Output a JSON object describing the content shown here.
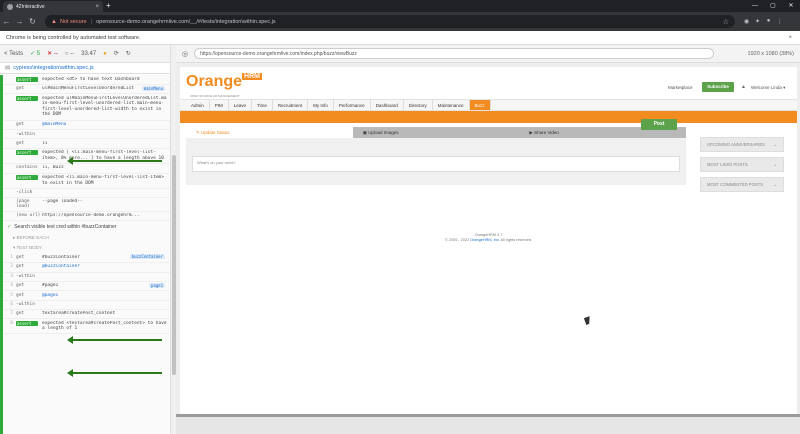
{
  "browser": {
    "tab_title": "42Interactive",
    "new_tab": "+",
    "not_secure": "Not secure",
    "url": "opensource-demo.orangehrmlive.com/__/#/tests/integration\\within.spec.js",
    "automation_notice": "Chrome is being controlled by automated test software."
  },
  "reporter": {
    "tests_label": "< Tests",
    "passed": "5",
    "failed": "--",
    "pending": "--",
    "duration": "33.47",
    "spec_path": "cypress\\integration\\within.spec.js",
    "commands_a": [
      {
        "num": "",
        "name": "assert",
        "msg": "expected <dt> to have text Dashboard",
        "tag": ""
      },
      {
        "num": "",
        "name": "get",
        "msg": "ul#mainMenuFirstLevelUnorderedList",
        "tag": "mainMenu"
      },
      {
        "num": "",
        "name": "assert",
        "msg": "expected ul#mainMenuFirstLevelUnorderedList.ma in-menu-first-level-unordered-list.main-menu-first-level-unordered-list-width to exist in the DOM",
        "tag": ""
      },
      {
        "num": "",
        "name": "get",
        "msg": "@mainMenu",
        "tag": ""
      },
      {
        "num": "",
        "name": "-within",
        "msg": "",
        "tag": ""
      },
      {
        "num": "",
        "name": "get",
        "msg": "li",
        "tag": ""
      },
      {
        "num": "",
        "name": "assert",
        "msg": "expected [ <li.main-menu-first-level-list-item>, 8% more... ] to have a length above 10",
        "tag": ""
      },
      {
        "num": "",
        "name": "contains",
        "msg": "li, Buzz",
        "tag": ""
      },
      {
        "num": "",
        "name": "assert",
        "msg": "expected <li.main-menu-first-level-list-item> to exist in the DOM",
        "tag": ""
      },
      {
        "num": "",
        "name": "-click",
        "msg": "",
        "tag": ""
      },
      {
        "num": "",
        "name": "(page load)",
        "msg": "--page loaded--",
        "tag": ""
      },
      {
        "num": "",
        "name": "(new url)",
        "msg": "https://opensource-demo.orangehrm...",
        "tag": ""
      }
    ],
    "test2_title": "Search visible text cred within #buzzContainer",
    "section_hooks": "BEFORE EACH",
    "section_body": "TEST BODY",
    "commands_b": [
      {
        "num": "1",
        "name": "get",
        "msg": "#buzzContainer",
        "tag": "buzzContainer"
      },
      {
        "num": "2",
        "name": "get",
        "msg": "@buzzContainer",
        "tag": ""
      },
      {
        "num": "3",
        "name": "-within",
        "msg": "",
        "tag": ""
      },
      {
        "num": "4",
        "name": "get",
        "msg": "#page1",
        "tag": "page1"
      },
      {
        "num": "5",
        "name": "get",
        "msg": "@page1",
        "tag": ""
      },
      {
        "num": "6",
        "name": "-within",
        "msg": "",
        "tag": ""
      },
      {
        "num": "7",
        "name": "get",
        "msg": "textarea#createPost_content",
        "tag": ""
      },
      {
        "num": "8",
        "name": "assert",
        "msg": "expected <textarea#createPost_content> to have a length of 1",
        "tag": ""
      }
    ]
  },
  "aut": {
    "url": "https://opensource-demo.orangehrmlive.com/index.php/buzz/viewBuzz",
    "resolution": "1920 x 1080 (38%)",
    "logo_orange": "Orange",
    "logo_hrm": "HRM",
    "logo_tagline": "OPEN SOURCE HR MANAGEMENT",
    "marketplace": "Marketplace",
    "subscribe": "Subscribe",
    "welcome": "Welcome Linda ▾",
    "menu": [
      "Admin",
      "PIM",
      "Leave",
      "Time",
      "Recruitment",
      "My Info",
      "Performance",
      "Dashboard",
      "Directory",
      "Maintenance",
      "Buzz"
    ],
    "tabs": [
      "Update Status",
      "Upload Images",
      "Share Video"
    ],
    "status_placeholder": "What's on your mind?",
    "post": "Post",
    "panels": [
      "UPCOMING ANNIVERSARIES",
      "MOST LIKED POSTS",
      "MOST COMMENTED POSTS"
    ],
    "footer_line1": "OrangeHRM 4.7",
    "footer_line2_pre": "© 2005 - 2022 ",
    "footer_link": "OrangeHRM, Inc",
    "footer_line2_post": ". All rights reserved."
  }
}
